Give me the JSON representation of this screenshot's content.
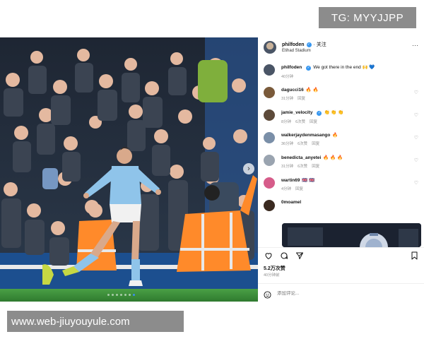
{
  "watermark_top": "TG: MYYJJPP",
  "watermark_bottom": "www.web-jiuyouyule.com",
  "colors": {
    "verified": "#3797f0",
    "pitch": "#3a8b3a",
    "jersey": "#8fc4ea",
    "steward_vest": "#ff8a2a",
    "carousel_dot_active": "#3d8ef0"
  },
  "post": {
    "username": "philfoden",
    "follow_label": "· 关注",
    "location": "Etihad Stadium",
    "more_icon": "more-horizontal-icon",
    "carousel": {
      "slide_count": 7,
      "active_index": 6
    }
  },
  "comments": [
    {
      "user": "philfoden",
      "verified": true,
      "text": "We got there in the end 🙌 💙",
      "meta": [
        "40分钟"
      ]
    },
    {
      "user": "dagucci16",
      "verified": false,
      "text": "🔥 🔥",
      "meta": [
        "31分钟",
        "回复"
      ]
    },
    {
      "user": "jamie_velocity",
      "verified": true,
      "text": "👏 👏 👏",
      "meta": [
        "8分钟",
        "6次赞",
        "回复"
      ]
    },
    {
      "user": "walkerjaydenmasango",
      "verified": false,
      "text": "🔥",
      "meta": [
        "36分钟",
        "6次赞",
        "回复"
      ]
    },
    {
      "user": "benedicta_anyetei",
      "verified": false,
      "text": "🔥 🔥 🔥",
      "meta": [
        "31分钟",
        "6次赞",
        "回复"
      ]
    },
    {
      "user": "wartin69",
      "verified": false,
      "text": "🇬🇧 🇬🇧",
      "meta": [
        "4分钟",
        "回复"
      ]
    },
    {
      "user": "0moamel",
      "verified": false,
      "text": "",
      "meta": []
    }
  ],
  "actions": {
    "likes": "5.2万次赞",
    "time": "40分钟前",
    "add_comment_placeholder": "添加评论..."
  }
}
